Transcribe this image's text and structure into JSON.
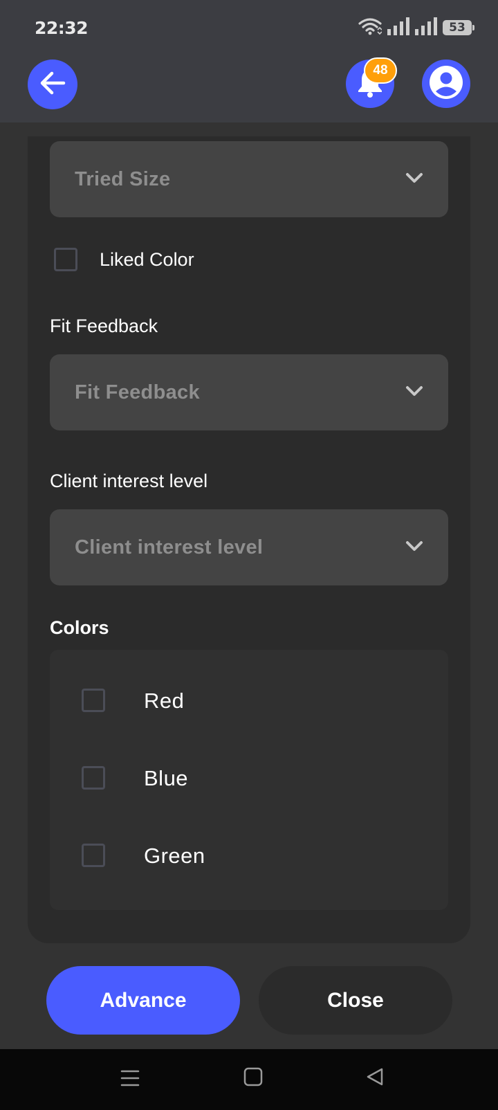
{
  "status_bar": {
    "time": "22:32",
    "battery": "53"
  },
  "header": {
    "notification_count": "48"
  },
  "form": {
    "tried_size_placeholder": "Tried Size",
    "liked_color_label": "Liked Color",
    "fit_feedback_label": "Fit Feedback",
    "fit_feedback_placeholder": "Fit Feedback",
    "interest_label": "Client interest level",
    "interest_placeholder": "Client interest level",
    "colors_title": "Colors",
    "colors": [
      {
        "label": "Red",
        "checked": false
      },
      {
        "label": "Blue",
        "checked": false
      },
      {
        "label": "Green",
        "checked": false
      }
    ]
  },
  "actions": {
    "advance_label": "Advance",
    "close_label": "Close"
  },
  "theme": {
    "accent": "#4a5cff",
    "badge": "#ff9f0a",
    "background": "#333333",
    "card": "#2b2b2b",
    "field": "#444444"
  }
}
